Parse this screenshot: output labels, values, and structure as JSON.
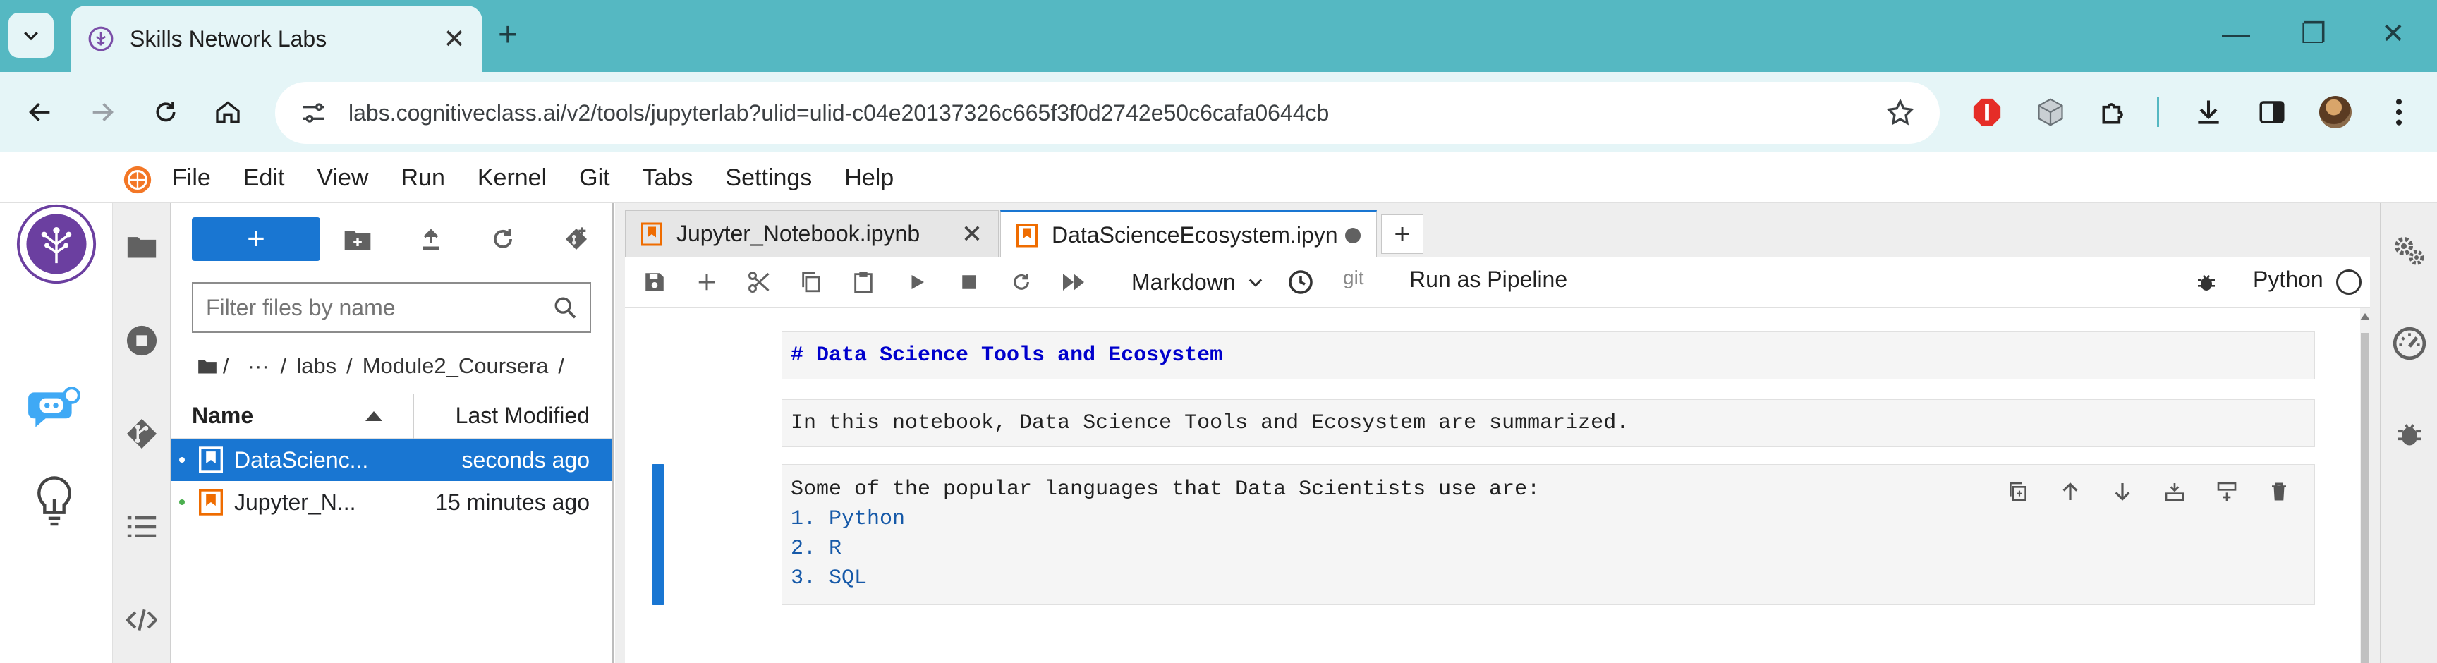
{
  "browser": {
    "tab_title": "Skills Network Labs",
    "url": "labs.cognitiveclass.ai/v2/tools/jupyterlab?ulid=ulid-c04e20137326c665f3f0d2742e50c6cafa0644cb",
    "colors": {
      "tabstrip": "#55b8c2",
      "toolbar": "#e5f5f7"
    }
  },
  "menubar": {
    "items": [
      "File",
      "Edit",
      "View",
      "Run",
      "Kernel",
      "Git",
      "Tabs",
      "Settings",
      "Help"
    ]
  },
  "filebrowser": {
    "new_label": "+",
    "filter_placeholder": "Filter files by name",
    "breadcrumb": [
      "/",
      "···",
      "/",
      "labs",
      "/",
      "Module2_Coursera",
      "/"
    ],
    "columns": {
      "name": "Name",
      "modified": "Last Modified"
    },
    "files": [
      {
        "name": "DataScienc...",
        "modified": "seconds ago",
        "selected": true
      },
      {
        "name": "Jupyter_N...",
        "modified": "15 minutes ago",
        "selected": false
      }
    ]
  },
  "doc_tabs": [
    {
      "label": "Jupyter_Notebook.ipynb",
      "active": false
    },
    {
      "label": "DataScienceEcosystem.ipyn",
      "active": true
    }
  ],
  "nb_toolbar": {
    "cell_type": "Markdown",
    "git_label": "git",
    "pipeline_label": "Run as Pipeline",
    "kernel_name": "Python"
  },
  "cells": [
    {
      "lines": [
        "# Data Science Tools and Ecosystem"
      ]
    },
    {
      "lines": [
        "In this notebook, Data Science Tools and Ecosystem are summarized."
      ]
    },
    {
      "lines": [
        "Some of the popular languages that Data Scientists use are:",
        "1. Python",
        "2. R",
        "3. SQL"
      ]
    }
  ],
  "icons": {
    "right_bar": [
      "property-inspector-icon",
      "resource-usage-icon",
      "debugger-icon"
    ],
    "side_tabs": [
      "folder-icon",
      "running-icon",
      "git-icon",
      "toc-icon",
      "extension-code-icon"
    ]
  },
  "accent": "#1976d2"
}
